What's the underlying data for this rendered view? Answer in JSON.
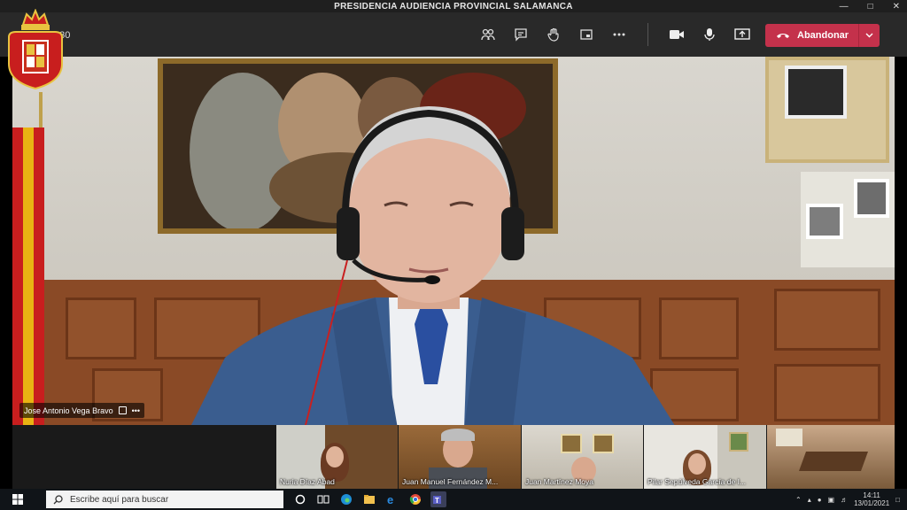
{
  "window": {
    "title": "PRESIDENCIA AUDIENCIA PROVINCIAL SALAMANCA"
  },
  "meeting": {
    "timer": "8:30",
    "leave_label": "Abandonar",
    "toolbar_icons": [
      "participants-icon",
      "chat-icon",
      "raise-hand-icon",
      "rooms-icon",
      "more-icon",
      "camera-icon",
      "microphone-icon",
      "share-icon"
    ],
    "main_speaker": "Jose Antonio Vega Bravo",
    "participants": [
      {
        "name": "Nuria Díaz Abad"
      },
      {
        "name": "Juan Manuel Fernández M..."
      },
      {
        "name": "Juan Martínez Moya"
      },
      {
        "name": "Pilar Sepúlveda García de I..."
      }
    ]
  },
  "taskbar": {
    "search_placeholder": "Escribe aquí para buscar",
    "time": "14:11",
    "date": "13/01/2021"
  },
  "colors": {
    "leave_button": "#c4314b",
    "toolbar": "#292929"
  }
}
